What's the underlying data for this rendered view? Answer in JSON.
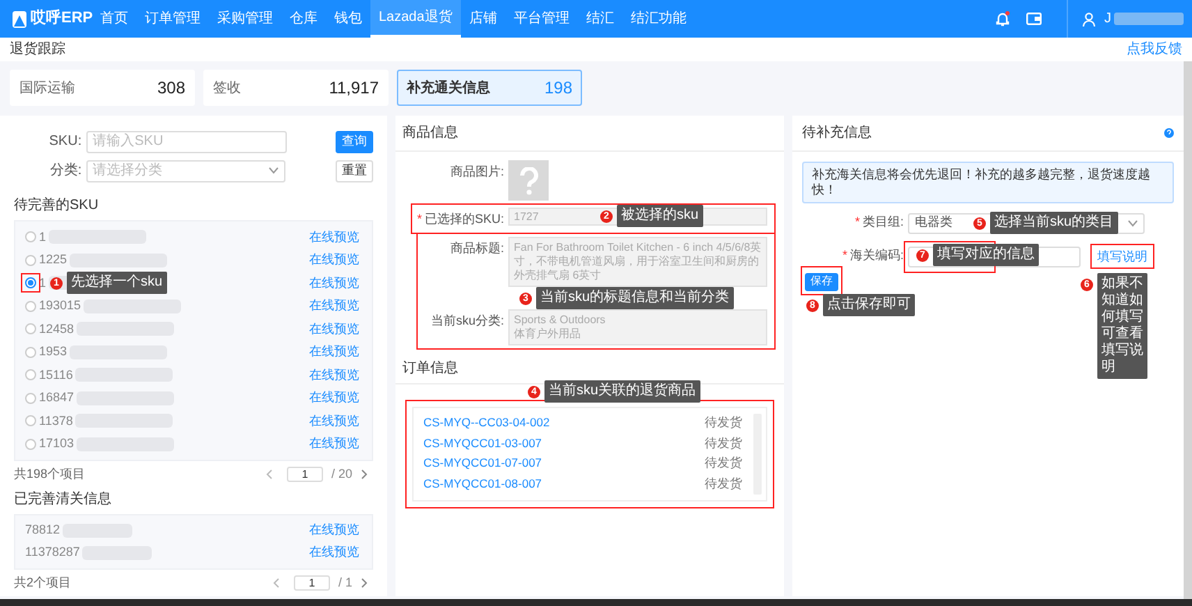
{
  "nav": {
    "logo": "哎呼ERP",
    "items": [
      {
        "label": "首页",
        "selected": false
      },
      {
        "label": "订单管理",
        "selected": false
      },
      {
        "label": "采购管理",
        "selected": false
      },
      {
        "label": "仓库",
        "selected": false
      },
      {
        "label": "钱包",
        "selected": false
      },
      {
        "label": "Lazada退货",
        "selected": true
      },
      {
        "label": "店铺",
        "selected": false
      },
      {
        "label": "平台管理",
        "selected": false
      },
      {
        "label": "结汇",
        "selected": false
      },
      {
        "label": "结汇功能",
        "selected": false
      }
    ],
    "user": "J"
  },
  "breadcrumb": "退货跟踪",
  "feedback": "点我反馈",
  "stats": [
    {
      "label": "国际运输",
      "value": "308",
      "selected": false
    },
    {
      "label": "签收",
      "value": "11,917",
      "selected": false
    },
    {
      "label": "补充通关信息",
      "value": "198",
      "selected": true
    }
  ],
  "left": {
    "sku_label": "SKU:",
    "sku_placeholder": "请输入SKU",
    "query_button": "查询",
    "category_label": "分类:",
    "category_placeholder": "请选择分类",
    "reset_button": "重置",
    "pending_title": "待完善的SKU",
    "pending": [
      {
        "sku": "1",
        "link": "在线预览",
        "selected": false
      },
      {
        "sku": "1225",
        "link": "在线预览",
        "selected": false
      },
      {
        "sku": "1",
        "link": "在线预览",
        "selected": true
      },
      {
        "sku": "193015",
        "link": "在线预览",
        "selected": false
      },
      {
        "sku": "12458",
        "link": "在线预览",
        "selected": false
      },
      {
        "sku": "1953",
        "link": "在线预览",
        "selected": false
      },
      {
        "sku": "15116",
        "link": "在线预览",
        "selected": false
      },
      {
        "sku": "16847",
        "link": "在线预览",
        "selected": false
      },
      {
        "sku": "11378",
        "link": "在线预览",
        "selected": false
      },
      {
        "sku": "17103",
        "link": "在线预览",
        "selected": false
      }
    ],
    "pending_total": "共198个项目",
    "page": "1",
    "page_total": "/ 20",
    "done_title": "已完善清关信息",
    "done": [
      {
        "sku": "78812",
        "link": "在线预览"
      },
      {
        "sku": "11378287",
        "link": "在线预览"
      }
    ],
    "done_total": "共2个项目",
    "done_page": "1",
    "done_page_total": "/ 1"
  },
  "middle": {
    "title": "商品信息",
    "image_label": "商品图片:",
    "sku_label": "已选择的SKU:",
    "sku_marker": "*",
    "sku_value": "1727",
    "title_label": "商品标题:",
    "product_title": "Fan For Bathroom Toilet Kitchen - 6 inch 4/5/6/8英寸，不带电机管道风扇，用于浴室卫生间和厨房的外壳排气扇 6英寸",
    "category_label": "当前sku分类:",
    "category_value": "Sports & Outdoors\n体育户外用品",
    "order_title": "订单信息",
    "orders": [
      {
        "code": "CS-MYQ--CC03-04-002",
        "status": "待发货"
      },
      {
        "code": "CS-MYQCC01-03-007",
        "status": "待发货"
      },
      {
        "code": "CS-MYQCC01-07-007",
        "status": "待发货"
      },
      {
        "code": "CS-MYQCC01-08-007",
        "status": "待发货"
      }
    ]
  },
  "right": {
    "title": "待补充信息",
    "alert": "补充海关信息将会优先退回！补充的越多越完整，退货速度越快！",
    "group_label": "类目组:",
    "group_marker": "*",
    "group_value": "电器类",
    "code_label": "海关编码:",
    "code_marker": "*",
    "help_link": "填写说明",
    "save_button": "保存"
  },
  "annotations": [
    {
      "number": "1",
      "text": "先选择一个sku"
    },
    {
      "number": "2",
      "text": "被选择的sku"
    },
    {
      "number": "3",
      "text": "当前sku的标题信息和当前分类"
    },
    {
      "number": "4",
      "text": "当前sku关联的退货商品"
    },
    {
      "number": "5",
      "text": "选择当前sku的类目"
    },
    {
      "number": "6",
      "text": "如果不知道如何填写可查看填写说明"
    },
    {
      "number": "7",
      "text": "填写对应的信息"
    },
    {
      "number": "8",
      "text": "点击保存即可"
    }
  ]
}
